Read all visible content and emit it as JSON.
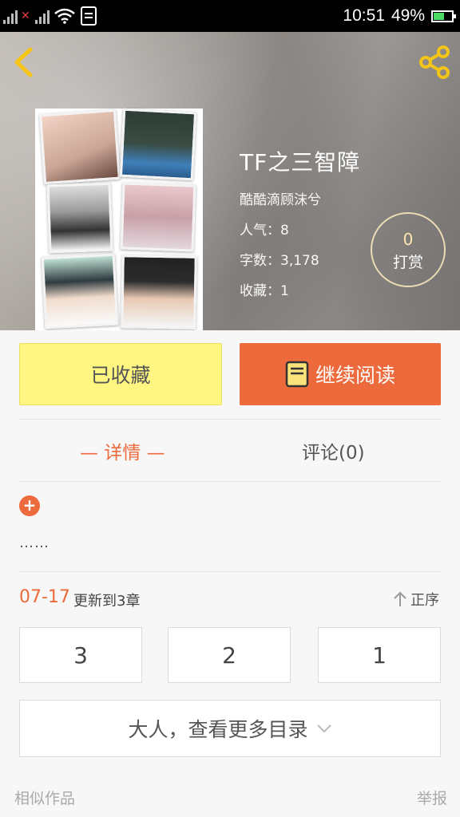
{
  "status_bar": {
    "time": "10:51",
    "battery": "49%",
    "battery_level": 0.49,
    "icons": [
      "signal-icon",
      "wifi-icon",
      "notification-icon",
      "battery-icon"
    ]
  },
  "header": {
    "back_icon": "chevron-left-icon",
    "share_icon": "share-icon"
  },
  "book": {
    "title": "TF之三智障",
    "author": "酷酷滴顾沫兮",
    "popularity": "人气：8",
    "word_count": "字数：3,178",
    "favorites": "收藏：1"
  },
  "tip": {
    "count": "0",
    "label": "打赏"
  },
  "actions": {
    "collected_label": "已收藏",
    "read_label": "继续阅读"
  },
  "tabs": {
    "detail": "— 详情 —",
    "comments": "评论(0)"
  },
  "description": {
    "text": "……"
  },
  "update": {
    "date": "07-17",
    "text": "更新到3章",
    "order_label": "正序"
  },
  "chapters": [
    "3",
    "2",
    "1"
  ],
  "more_catalog": "大人，查看更多目录",
  "footer": {
    "similar": "相似作品",
    "report": "举报"
  },
  "colors": {
    "accent": "#ec6a3c",
    "collected_bg": "#fef681",
    "page_bg": "#f7f7f7"
  }
}
